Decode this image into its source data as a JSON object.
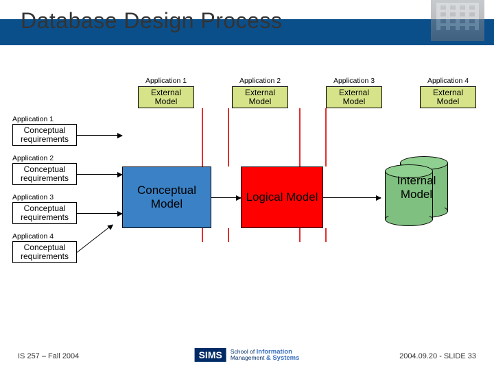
{
  "title": "Database Design Process",
  "top": {
    "cols": [
      {
        "label": "Application 1",
        "box": "External Model"
      },
      {
        "label": "Application 2",
        "box": "External Model"
      },
      {
        "label": "Application 3",
        "box": "External Model"
      },
      {
        "label": "Application 4",
        "box": "External Model"
      }
    ]
  },
  "left": {
    "rows": [
      {
        "label": "Application 1",
        "box": "Conceptual requirements"
      },
      {
        "label": "Application 2",
        "box": "Conceptual requirements"
      },
      {
        "label": "Application 3",
        "box": "Conceptual requirements"
      },
      {
        "label": "Application 4",
        "box": "Conceptual requirements"
      }
    ]
  },
  "center": {
    "conceptual": "Conceptual Model",
    "logical": "Logical Model",
    "internal": "Internal Model"
  },
  "footer": {
    "left": "IS 257 – Fall 2004",
    "right": "2004.09.20 - SLIDE 33",
    "logo_primary": "SIMS",
    "logo_line1_a": "School of",
    "logo_line1_b": "Information",
    "logo_line2_a": "Management",
    "logo_line2_b": "& Systems"
  }
}
